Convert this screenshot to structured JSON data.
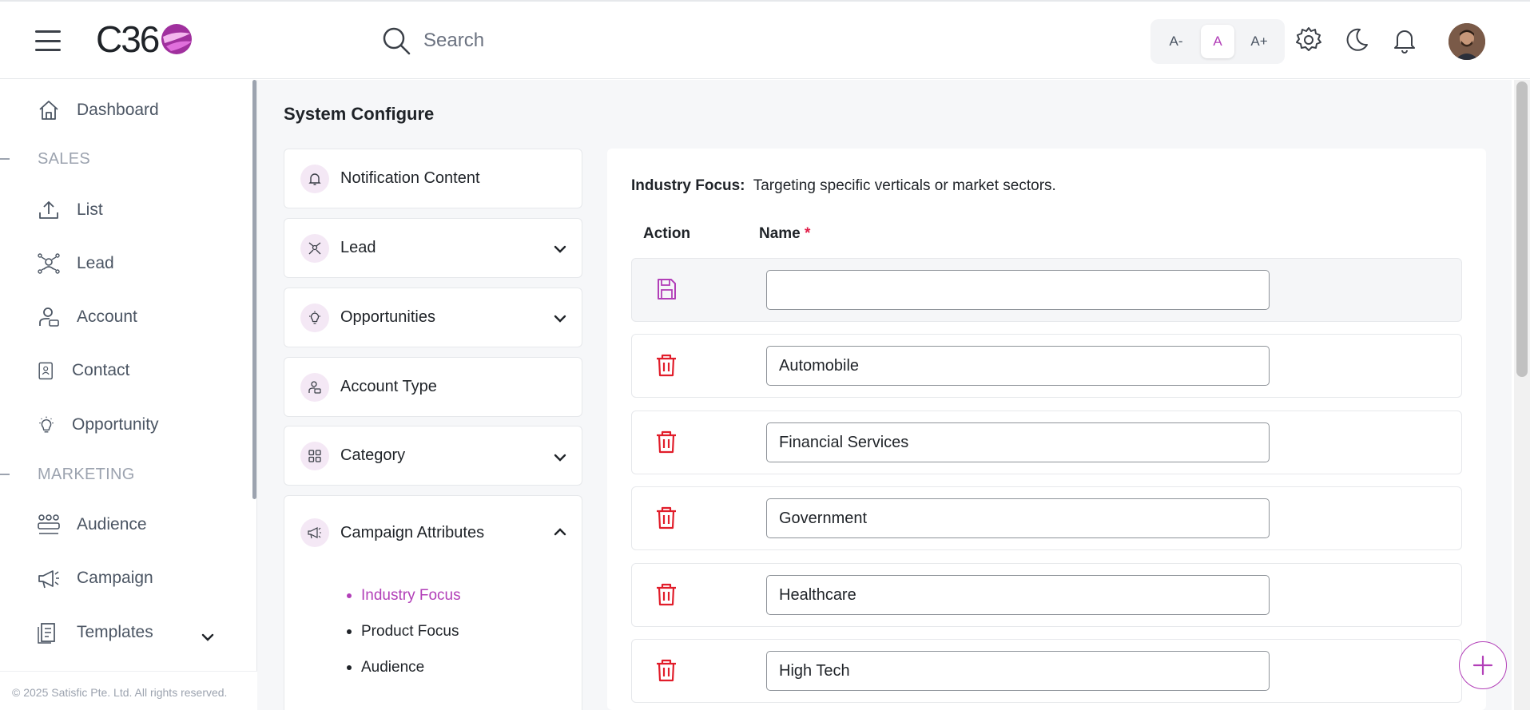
{
  "header": {
    "logo_text": "C36",
    "search_placeholder": "Search",
    "font_controls": [
      "A-",
      "A",
      "A+"
    ]
  },
  "sidebar": {
    "items": [
      {
        "label": "Dashboard",
        "icon": "home-icon"
      },
      {
        "label": "List",
        "icon": "upload-icon"
      },
      {
        "label": "Lead",
        "icon": "lead-network-icon"
      },
      {
        "label": "Account",
        "icon": "account-icon"
      },
      {
        "label": "Contact",
        "icon": "contact-icon"
      },
      {
        "label": "Opportunity",
        "icon": "lightbulb-icon"
      },
      {
        "label": "Audience",
        "icon": "audience-icon"
      },
      {
        "label": "Campaign",
        "icon": "megaphone-icon"
      },
      {
        "label": "Templates",
        "icon": "templates-icon"
      }
    ],
    "sections": [
      "SALES",
      "MARKETING"
    ],
    "footer": "© 2025 Satisfic Pte. Ltd. All rights reserved."
  },
  "main": {
    "title": "System Configure",
    "config_items": [
      {
        "label": "Notification Content",
        "icon": "bell-icon"
      },
      {
        "label": "Lead",
        "icon": "lead-network-icon"
      },
      {
        "label": "Opportunities",
        "icon": "lightbulb-icon"
      },
      {
        "label": "Account Type",
        "icon": "account-icon"
      },
      {
        "label": "Category",
        "icon": "grid-icon"
      },
      {
        "label": "Campaign Attributes",
        "icon": "megaphone-icon"
      }
    ],
    "campaign_sub_items": [
      "Industry Focus",
      "Product Focus",
      "Audience"
    ],
    "active_sub_item": "Industry Focus",
    "panel": {
      "title": "Industry Focus:",
      "description": "Targeting specific verticals or market sectors.",
      "col_action": "Action",
      "col_name": "Name",
      "required_mark": "*",
      "new_row_value": "",
      "rows": [
        "Automobile",
        "Financial Services",
        "Government",
        "Healthcare",
        "High Tech"
      ]
    }
  },
  "colors": {
    "accent": "#b23fb8",
    "delete": "#e11d2a"
  }
}
